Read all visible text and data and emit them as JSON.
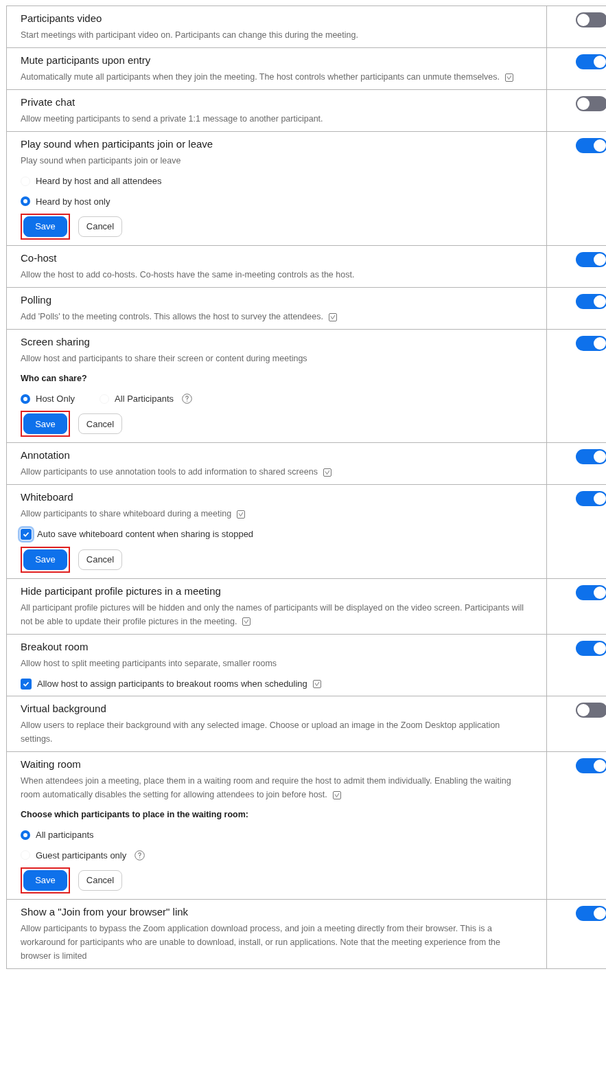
{
  "settings": [
    {
      "title": "Participants video",
      "description": "Start meetings with participant video on. Participants can change this during the meeting.",
      "on": false
    },
    {
      "title": "Mute participants upon entry",
      "description": "Automatically mute all participants when they join the meeting. The host controls whether participants can unmute themselves.",
      "info": true,
      "on": true
    },
    {
      "title": "Private chat",
      "description": "Allow meeting participants to send a private 1:1 message to another participant.",
      "on": false
    },
    {
      "title": "Play sound when participants join or leave",
      "description": "Play sound when participants join or leave",
      "on": true,
      "options": [
        {
          "kind": "radio",
          "label": "Heard by host and all attendees",
          "selected": false
        },
        {
          "kind": "radio",
          "label": "Heard by host only",
          "selected": true
        }
      ],
      "buttons": [
        {
          "kind": "primary",
          "label": "Save",
          "highlighted": true
        },
        {
          "kind": "secondary",
          "label": "Cancel",
          "highlighted": false
        }
      ]
    },
    {
      "title": "Co-host",
      "description": "Allow the host to add co-hosts. Co-hosts have the same in-meeting controls as the host.",
      "on": true
    },
    {
      "title": "Polling",
      "description": "Add 'Polls' to the meeting controls. This allows the host to survey the attendees.",
      "info": true,
      "on": true
    },
    {
      "title": "Screen sharing",
      "description": "Allow host and participants to share their screen or content during meetings",
      "on": true,
      "subheading": "Who can share?",
      "inline_options": true,
      "options": [
        {
          "kind": "radio",
          "label": "Host Only",
          "selected": true
        },
        {
          "kind": "radio",
          "label": "All Participants",
          "selected": false,
          "help": true
        }
      ],
      "buttons": [
        {
          "kind": "primary",
          "label": "Save",
          "highlighted": true
        },
        {
          "kind": "secondary",
          "label": "Cancel",
          "highlighted": false
        }
      ]
    },
    {
      "title": "Annotation",
      "description": "Allow participants to use annotation tools to add information to shared screens",
      "info": true,
      "on": true
    },
    {
      "title": "Whiteboard",
      "description": "Allow participants to share whiteboard during a meeting",
      "info": true,
      "on": true,
      "options": [
        {
          "kind": "checkbox",
          "label": "Auto save whiteboard content when sharing is stopped",
          "checked": true,
          "focused": true
        }
      ],
      "buttons": [
        {
          "kind": "primary",
          "label": "Save",
          "highlighted": true
        },
        {
          "kind": "secondary",
          "label": "Cancel",
          "highlighted": false
        }
      ]
    },
    {
      "title": "Hide participant profile pictures in a meeting",
      "description": "All participant profile pictures will be hidden and only the names of participants will be displayed on the video screen. Participants will not be able to update their profile pictures in the meeting.",
      "info": true,
      "on": true
    },
    {
      "title": "Breakout room",
      "description": "Allow host to split meeting participants into separate, smaller rooms",
      "on": true,
      "options": [
        {
          "kind": "checkbox",
          "label": "Allow host to assign participants to breakout rooms when scheduling",
          "checked": true,
          "focused": false,
          "info": true
        }
      ]
    },
    {
      "title": "Virtual background",
      "description": "Allow users to replace their background with any selected image. Choose or upload an image in the Zoom Desktop application settings.",
      "on": false
    },
    {
      "title": "Waiting room",
      "description": "When attendees join a meeting, place them in a waiting room and require the host to admit them individually. Enabling the waiting room automatically disables the setting for allowing attendees to join before host.",
      "info": true,
      "on": true,
      "subheading": "Choose which participants to place in the waiting room:",
      "options": [
        {
          "kind": "radio",
          "label": "All participants",
          "selected": true
        },
        {
          "kind": "radio",
          "label": "Guest participants only",
          "selected": false,
          "help": true
        }
      ],
      "buttons": [
        {
          "kind": "primary",
          "label": "Save",
          "highlighted": true
        },
        {
          "kind": "secondary",
          "label": "Cancel",
          "highlighted": false
        }
      ]
    },
    {
      "title": "Show a \"Join from your browser\" link",
      "description": "Allow participants to bypass the Zoom application download process, and join a meeting directly from their browser. This is a workaround for participants who are unable to download, install, or run applications. Note that the meeting experience from the browser is limited",
      "on": true
    }
  ]
}
